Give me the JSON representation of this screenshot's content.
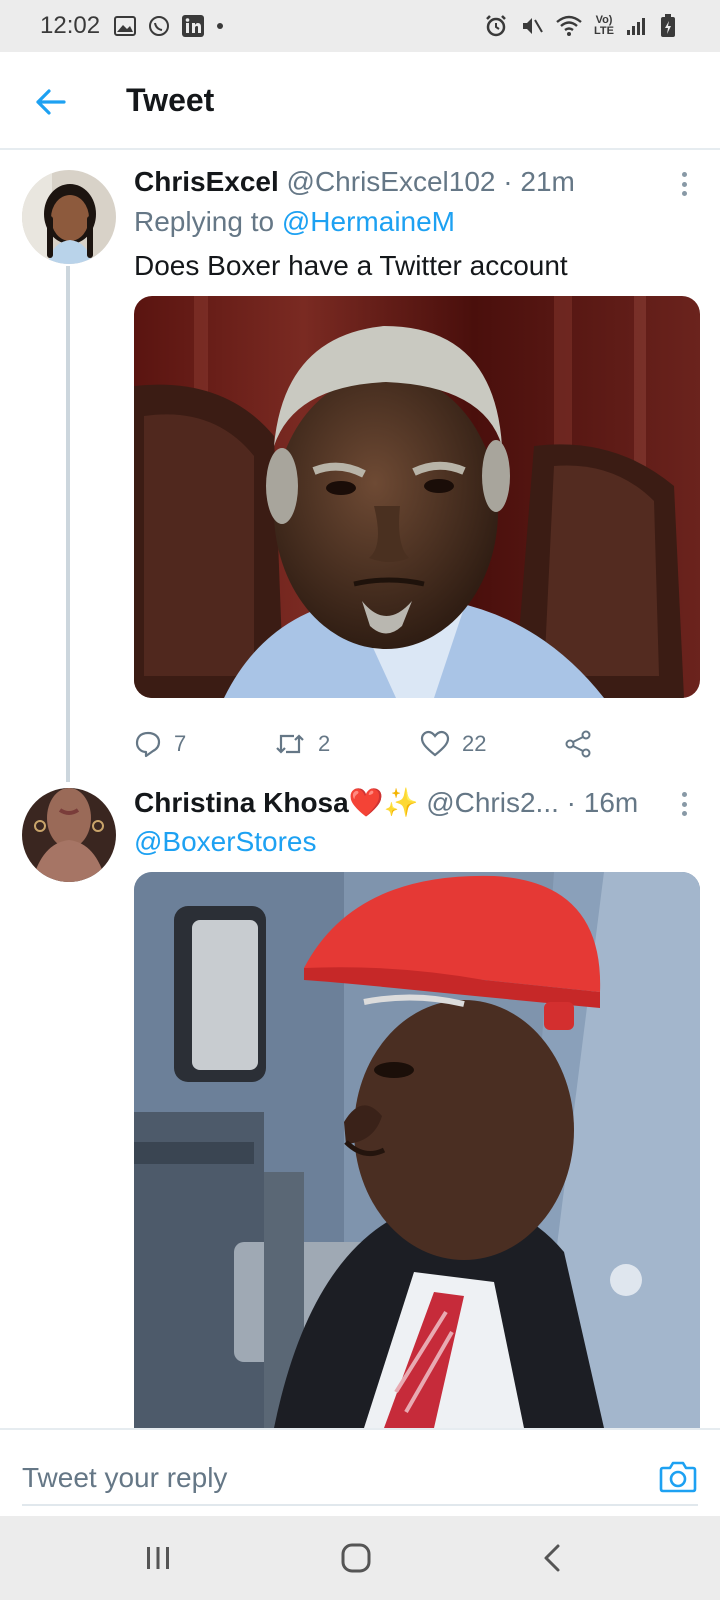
{
  "status_bar": {
    "time": "12:02",
    "left_icons": [
      "gallery-icon",
      "whatsapp-icon",
      "linkedin-icon",
      "dot-icon"
    ],
    "right_icons": [
      "alarm-icon",
      "mute-icon",
      "wifi-icon",
      "volte-icon",
      "signal-icon",
      "battery-icon"
    ],
    "volte_line1": "Vo)",
    "volte_line2": "LTE"
  },
  "header": {
    "back_icon": "arrow-left-icon",
    "title": "Tweet"
  },
  "tweets": [
    {
      "display_name": "ChrisExcel",
      "handle": "@ChrisExcel102",
      "separator": "·",
      "time": "21m",
      "replying_prefix": "Replying to",
      "replying_to": "@HermaineM",
      "text": "Does Boxer have a Twitter account",
      "media_description": "photo",
      "actions": {
        "replies": "7",
        "retweets": "2",
        "likes": "22"
      }
    },
    {
      "display_name": "Christina Khosa",
      "name_emoji": "❤️✨",
      "handle": "@Chris2...",
      "separator": "·",
      "time": "16m",
      "mention": "@BoxerStores",
      "media_description": "photo"
    }
  ],
  "reply_bar": {
    "placeholder": "Tweet your reply",
    "camera_icon": "camera-icon"
  },
  "nav_bar": {
    "buttons": [
      "recent-apps-icon",
      "home-icon",
      "back-icon"
    ]
  },
  "colors": {
    "accent": "#1da1f2",
    "muted_text": "#657786",
    "like_heart": "#e0245e",
    "helmet_red": "#e53935"
  }
}
